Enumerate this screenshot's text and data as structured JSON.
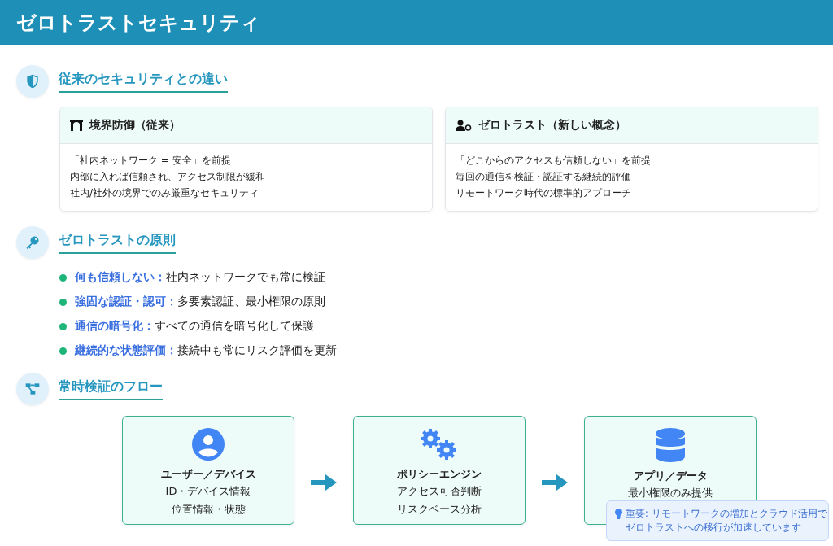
{
  "header": {
    "title": "ゼロトラストセキュリティ"
  },
  "sections": [
    {
      "kind": "compare",
      "heading": "従来のセキュリティとの違い",
      "cards": [
        {
          "title": "境界防御（従来）",
          "lines": [
            "「社内ネットワーク = 安全」を前提",
            "内部に入れば信頼され、アクセス制限が緩和",
            "社内/社外の境界でのみ厳重なセキュリティ"
          ]
        },
        {
          "title": "ゼロトラスト（新しい概念）",
          "lines": [
            "「どこからのアクセスも信頼しない」を前提",
            "毎回の通信を検証・認証する継続的評価",
            "リモートワーク時代の標準的アプローチ"
          ]
        }
      ]
    },
    {
      "kind": "principles",
      "heading": "ゼロトラストの原則",
      "items": [
        {
          "term": "何も信頼しない：",
          "text": "社内ネットワークでも常に検証"
        },
        {
          "term": "強固な認証・認可：",
          "text": "多要素認証、最小権限の原則"
        },
        {
          "term": "通信の暗号化：",
          "text": "すべての通信を暗号化して保護"
        },
        {
          "term": "継続的な状態評価：",
          "text": "接続中も常にリスク評価を更新"
        }
      ]
    },
    {
      "kind": "flow",
      "heading": "常時検証のフロー",
      "steps": [
        {
          "title": "ユーザー／デバイス",
          "lines": [
            "ID・デバイス情報",
            "位置情報・状態"
          ]
        },
        {
          "title": "ポリシーエンジン",
          "lines": [
            "アクセス可否判断",
            "リスクベース分析"
          ]
        },
        {
          "title": "アプリ／データ",
          "lines": [
            "最小権限のみ提供"
          ]
        }
      ],
      "note": {
        "lines": [
          "重要: リモートワークの増加とクラウド活用で",
          "ゼロトラストへの移行が加速しています"
        ]
      }
    }
  ]
}
